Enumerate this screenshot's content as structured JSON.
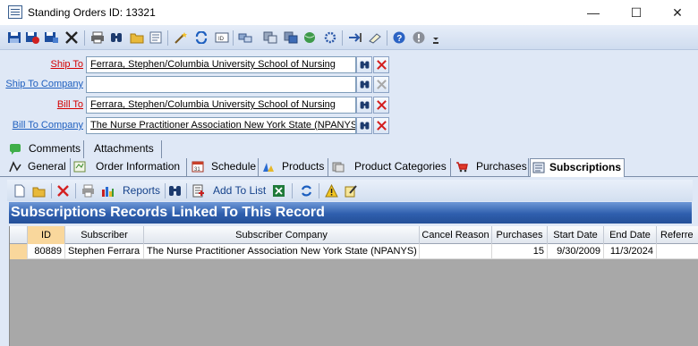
{
  "window": {
    "title": "Standing Orders ID: 13321",
    "minimize_glyph": "—",
    "maximize_glyph": "☐",
    "close_glyph": "✕"
  },
  "toolbar": {
    "icons": [
      "save-icon",
      "save-close-icon",
      "save-new-icon",
      "delete-icon",
      "print-icon",
      "find-icon",
      "open-folder-icon",
      "notes-icon",
      "magic-icon",
      "refresh-icon",
      "id-icon",
      "copy-icon",
      "duplicate-icon",
      "globe-icon",
      "settings-icon",
      "link-icon",
      "attach-icon",
      "help-icon",
      "info-icon",
      "overflow-icon"
    ]
  },
  "form": {
    "ship_to": {
      "label": "Ship To",
      "value": "Ferrara, Stephen/Columbia University School of Nursing"
    },
    "ship_to_company": {
      "label": "Ship To Company",
      "value": ""
    },
    "bill_to": {
      "label": "Bill To",
      "value": "Ferrara, Stephen/Columbia University School of Nursing"
    },
    "bill_to_company": {
      "label": "Bill To Company",
      "value": "The Nurse Practitioner Association New York State (NPANYS)"
    }
  },
  "tabs_top": [
    {
      "label": "Comments"
    },
    {
      "label": "Attachments"
    }
  ],
  "tabs_main": [
    {
      "label": "General"
    },
    {
      "label": "Order Information"
    },
    {
      "label": "Schedule"
    },
    {
      "label": "Products"
    },
    {
      "label": "Product Categories"
    },
    {
      "label": "Purchases"
    },
    {
      "label": "Subscriptions",
      "active": true
    }
  ],
  "subtoolbar": {
    "reports_label": "Reports",
    "add_to_list_label": "Add To List"
  },
  "grid": {
    "title": "Subscriptions Records Linked To This Record",
    "columns": [
      "ID",
      "Subscriber",
      "Subscriber Company",
      "Cancel Reason",
      "Purchases",
      "Start Date",
      "End Date",
      "Referre"
    ],
    "rows": [
      {
        "id": "80889",
        "subscriber": "Stephen Ferrara",
        "subscriber_company": "The Nurse Practitioner Association New York State (NPANYS)",
        "cancel_reason": "",
        "purchases": "15",
        "start_date": "9/30/2009",
        "end_date": "11/3/2024",
        "referrer": ""
      }
    ]
  },
  "colors": {
    "required_label": "#d40000",
    "link_label": "#1f5fbf",
    "grid_title_bg": "#2f5fae",
    "id_column_bg": "#f9d79c"
  }
}
